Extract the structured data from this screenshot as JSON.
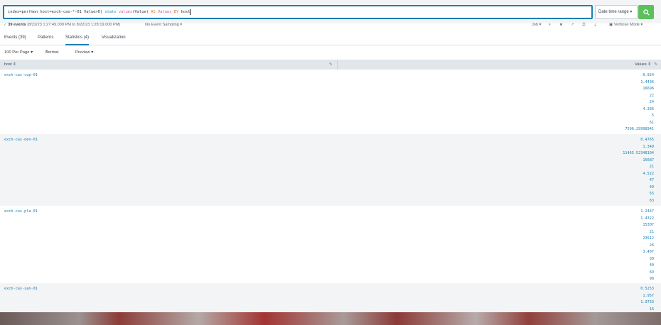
{
  "search": {
    "part1": "index=perfmon  host=exch-cas-*-01 Value>0",
    "pipe": "| ",
    "cmd": "stats ",
    "fn": "values",
    "fnarg": "(Value) ",
    "as": "AS",
    "alias": " Values ",
    "by": "BY",
    "field": " host"
  },
  "time_range": {
    "label": "Date time range ▾"
  },
  "status": {
    "check": "✓",
    "events_count": "39 events",
    "range": "(8/22/23 1:27:49.000 PM to 8/22/23 1:28:19.000 PM)",
    "sampling": "No Event Sampling ▾",
    "job": "Job ▾",
    "mode": "Verbose Mode ▾"
  },
  "tabs": [
    {
      "label": "Events (39)"
    },
    {
      "label": "Patterns"
    },
    {
      "label": "Statistics (4)"
    },
    {
      "label": "Visualization"
    }
  ],
  "options": {
    "per_page": "100 Per Page ▾",
    "format": "Format",
    "preview": "Preview ▾"
  },
  "table": {
    "col_host": "host ⇕",
    "col_values": "Values ⇕",
    "rows": [
      {
        "host": "exch-cas-cup-01",
        "values": [
          "0.924",
          "1.4436",
          "16696",
          "22",
          "24",
          "4.336",
          "5",
          "61",
          "7506.29998941"
        ]
      },
      {
        "host": "exch-cas-den-01",
        "values": [
          "0.4765",
          "1.349",
          "11465.52348194",
          "15687",
          "21",
          "4.522",
          "47",
          "49",
          "55",
          "63"
        ]
      },
      {
        "host": "exch-cas-pla-01",
        "values": [
          "1.2447",
          "1.4322",
          "15307",
          "21",
          "23512",
          "26",
          "3.407",
          "30",
          "40",
          "69",
          "98"
        ]
      },
      {
        "host": "exch-cas-san-01",
        "values": [
          "0.5253",
          "1.957",
          "1.9733",
          "16"
        ]
      }
    ]
  },
  "colors": {
    "accent": "#1a7fb5",
    "search_button": "#5cc05c",
    "header_bg": "#e1e6eb",
    "alt_row_bg": "#f2f4f5"
  },
  "icons": [
    "search-icon",
    "pencil-icon",
    "pause-icon",
    "stop-icon",
    "share-icon",
    "print-icon",
    "download-icon",
    "mode-icon"
  ]
}
